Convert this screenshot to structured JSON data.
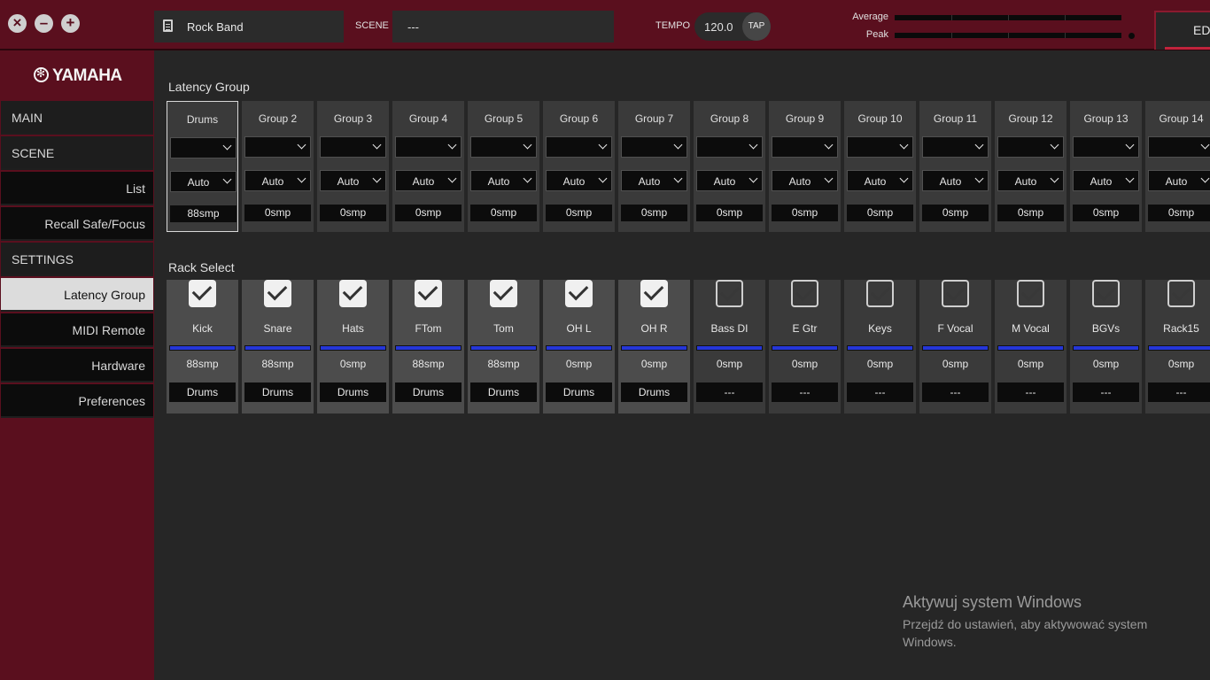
{
  "window_controls": [
    "close-icon",
    "minimize-icon",
    "maximize-icon"
  ],
  "topbar": {
    "project_name": "Rock Band",
    "scene_label": "SCENE",
    "scene_value": "---",
    "tempo_label": "TEMPO",
    "tempo_value": "120.0",
    "tap_label": "TAP",
    "average_label": "Average",
    "peak_label": "Peak",
    "edit_tab_label": "EDI"
  },
  "sidebar": {
    "logo_text": "YAMAHA",
    "items": [
      {
        "label": "MAIN",
        "kind": "head"
      },
      {
        "label": "SCENE",
        "kind": "head"
      },
      {
        "label": "List",
        "kind": "sub"
      },
      {
        "label": "Recall Safe/Focus",
        "kind": "sub"
      },
      {
        "label": "SETTINGS",
        "kind": "head"
      },
      {
        "label": "Latency Group",
        "kind": "sub",
        "active": true
      },
      {
        "label": "MIDI Remote",
        "kind": "sub"
      },
      {
        "label": "Hardware",
        "kind": "sub"
      },
      {
        "label": "Preferences",
        "kind": "sub"
      }
    ]
  },
  "latency_group": {
    "title": "Latency Group",
    "groups": [
      {
        "name": "Drums",
        "select": "",
        "mode": "Auto",
        "smp": "88smp",
        "selected": true
      },
      {
        "name": "Group 2",
        "select": "",
        "mode": "Auto",
        "smp": "0smp"
      },
      {
        "name": "Group 3",
        "select": "",
        "mode": "Auto",
        "smp": "0smp"
      },
      {
        "name": "Group 4",
        "select": "",
        "mode": "Auto",
        "smp": "0smp"
      },
      {
        "name": "Group 5",
        "select": "",
        "mode": "Auto",
        "smp": "0smp"
      },
      {
        "name": "Group 6",
        "select": "",
        "mode": "Auto",
        "smp": "0smp"
      },
      {
        "name": "Group 7",
        "select": "",
        "mode": "Auto",
        "smp": "0smp"
      },
      {
        "name": "Group 8",
        "select": "",
        "mode": "Auto",
        "smp": "0smp"
      },
      {
        "name": "Group 9",
        "select": "",
        "mode": "Auto",
        "smp": "0smp"
      },
      {
        "name": "Group 10",
        "select": "",
        "mode": "Auto",
        "smp": "0smp"
      },
      {
        "name": "Group 11",
        "select": "",
        "mode": "Auto",
        "smp": "0smp"
      },
      {
        "name": "Group 12",
        "select": "",
        "mode": "Auto",
        "smp": "0smp"
      },
      {
        "name": "Group 13",
        "select": "",
        "mode": "Auto",
        "smp": "0smp"
      },
      {
        "name": "Group 14",
        "select": "",
        "mode": "Auto",
        "smp": "0smp"
      }
    ]
  },
  "rack_select": {
    "title": "Rack Select",
    "racks": [
      {
        "name": "Kick",
        "checked": true,
        "smp": "88smp",
        "group": "Drums"
      },
      {
        "name": "Snare",
        "checked": true,
        "smp": "88smp",
        "group": "Drums"
      },
      {
        "name": "Hats",
        "checked": true,
        "smp": "0smp",
        "group": "Drums"
      },
      {
        "name": "FTom",
        "checked": true,
        "smp": "88smp",
        "group": "Drums"
      },
      {
        "name": "Tom",
        "checked": true,
        "smp": "88smp",
        "group": "Drums"
      },
      {
        "name": "OH L",
        "checked": true,
        "smp": "0smp",
        "group": "Drums"
      },
      {
        "name": "OH R",
        "checked": true,
        "smp": "0smp",
        "group": "Drums"
      },
      {
        "name": "Bass DI",
        "checked": false,
        "smp": "0smp",
        "group": "---"
      },
      {
        "name": "E Gtr",
        "checked": false,
        "smp": "0smp",
        "group": "---"
      },
      {
        "name": "Keys",
        "checked": false,
        "smp": "0smp",
        "group": "---"
      },
      {
        "name": "F Vocal",
        "checked": false,
        "smp": "0smp",
        "group": "---"
      },
      {
        "name": "M Vocal",
        "checked": false,
        "smp": "0smp",
        "group": "---"
      },
      {
        "name": "BGVs",
        "checked": false,
        "smp": "0smp",
        "group": "---"
      },
      {
        "name": "Rack15",
        "checked": false,
        "smp": "0smp",
        "group": "---"
      }
    ]
  },
  "watermark": {
    "title": "Aktywuj system Windows",
    "subtitle": "Przejdź do ustawień, aby aktywować system Windows."
  },
  "colors": {
    "chrome": "#5a0f1e",
    "rack_bar": "#2536d8",
    "background": "#262626"
  }
}
